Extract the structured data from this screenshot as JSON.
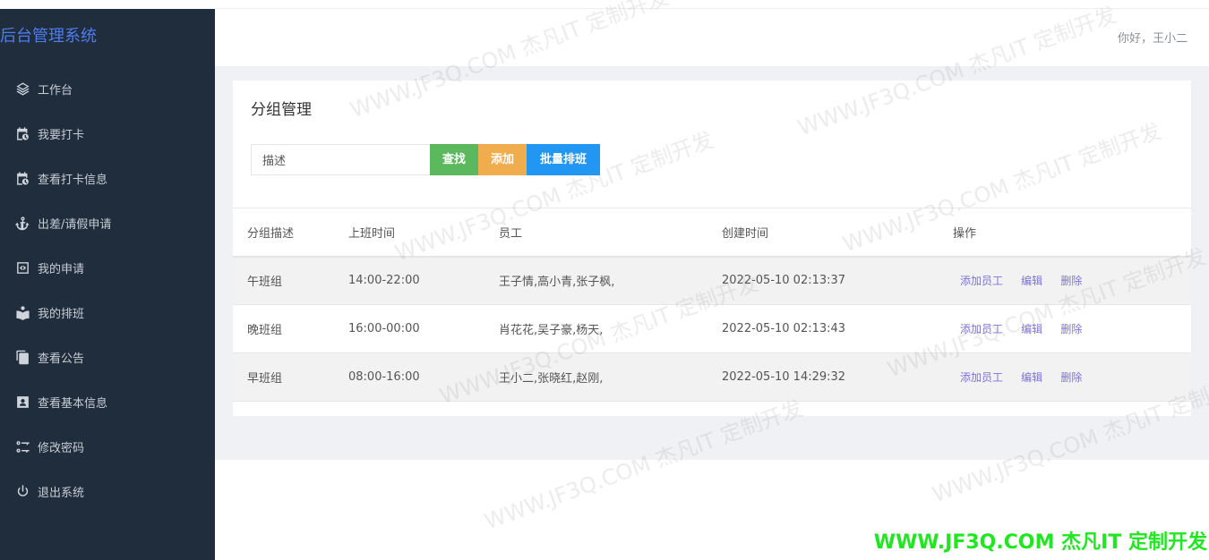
{
  "app": {
    "title": "后台管理系统"
  },
  "header": {
    "greeting": "你好，王小二"
  },
  "sidebar": {
    "items": [
      {
        "label": "工作台",
        "icon": "dashboard-icon"
      },
      {
        "label": "我要打卡",
        "icon": "calendar-clock-icon"
      },
      {
        "label": "查看打卡信息",
        "icon": "calendar-clock-icon"
      },
      {
        "label": "出差/请假申请",
        "icon": "anchor-icon"
      },
      {
        "label": "我的申请",
        "icon": "code-box-icon"
      },
      {
        "label": "我的排班",
        "icon": "book-user-icon"
      },
      {
        "label": "查看公告",
        "icon": "copy-icon"
      },
      {
        "label": "查看基本信息",
        "icon": "id-card-icon"
      },
      {
        "label": "修改密码",
        "icon": "key-icon"
      },
      {
        "label": "退出系统",
        "icon": "power-icon"
      }
    ]
  },
  "main": {
    "title": "分组管理",
    "search": {
      "value": "描述",
      "placeholder": "描述"
    },
    "buttons": {
      "find": "查找",
      "add": "添加",
      "batch": "批量排班"
    },
    "colors": {
      "find": "#5cb85c",
      "add": "#f0ad4e",
      "batch": "#2196f3",
      "sidebar": "#1f2d3d",
      "brand": "#4f7cf2"
    },
    "table": {
      "headers": [
        "分组描述",
        "上班时间",
        "员工",
        "创建时间",
        "操作"
      ],
      "rows": [
        {
          "desc": "午班组",
          "time": "14:00-22:00",
          "staff": "王子情,高小青,张子枫,",
          "created": "2022-05-10 02:13:37"
        },
        {
          "desc": "晚班组",
          "time": "16:00-00:00",
          "staff": "肖花花,吴子豪,杨天,",
          "created": "2022-05-10 02:13:43"
        },
        {
          "desc": "早班组",
          "time": "08:00-16:00",
          "staff": "王小二,张晓红,赵刚,",
          "created": "2022-05-10 14:29:32"
        }
      ],
      "actions": {
        "add_staff": "添加员工",
        "edit": "编辑",
        "delete": "删除"
      }
    }
  },
  "watermark": {
    "text": "WWW.JF3Q.COM 杰凡IT 定制开发",
    "bottom_text": "WWW.JF3Q.COM 杰凡IT  定制开发"
  }
}
